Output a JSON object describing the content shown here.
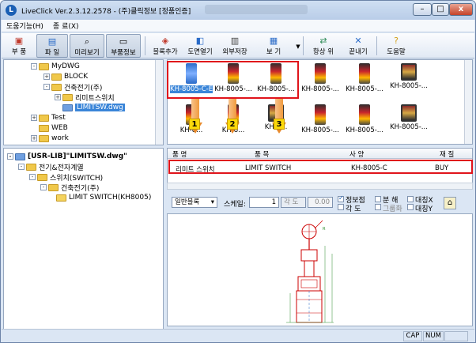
{
  "window": {
    "title": "LiveClick Ver.2.3.12.2578 - (주)클릭정보 [정품인증]",
    "minimize_glyph": "–",
    "maximize_glyph": "□",
    "close_glyph": "x"
  },
  "menubar": {
    "items": [
      "도움기능(H)",
      "종 료(X)"
    ]
  },
  "toolbar": {
    "buttons": [
      {
        "label": "부 품",
        "icon": "parts-icon"
      },
      {
        "label": "파 일",
        "icon": "file-icon"
      },
      {
        "label": "미리보기",
        "icon": "preview-icon"
      },
      {
        "label": "부품정보",
        "icon": "info-icon"
      },
      {
        "label": "블록추가",
        "icon": "add-block-icon"
      },
      {
        "label": "도면열기",
        "icon": "open-drawing-icon"
      },
      {
        "label": "외부저장",
        "icon": "save-icon"
      },
      {
        "label": "보 기",
        "icon": "view-icon"
      },
      {
        "label": "항상 위",
        "icon": "pin-icon"
      },
      {
        "label": "끝내기",
        "icon": "exit-icon"
      },
      {
        "label": "도움말",
        "icon": "help-icon"
      }
    ]
  },
  "folder_tree": {
    "items": [
      {
        "label": "MyDWG",
        "exp": "-"
      },
      {
        "label": "BLOCK",
        "exp": "+"
      },
      {
        "label": "건축전기(주)",
        "exp": "-"
      },
      {
        "label": "리미트스위치",
        "exp": "+"
      },
      {
        "label": "LIMITSW.dwg",
        "exp": ""
      },
      {
        "label": "Test",
        "exp": "+"
      },
      {
        "label": "WEB",
        "exp": ""
      },
      {
        "label": "work",
        "exp": "+"
      }
    ]
  },
  "library_tree": {
    "items": [
      {
        "label": "[USR-LIB]\"LIMITSW.dwg\"",
        "exp": "-"
      },
      {
        "label": "전기&전자계열",
        "exp": "-"
      },
      {
        "label": "스위치(SWITCH)",
        "exp": "-"
      },
      {
        "label": "건축전기(주)",
        "exp": "-"
      },
      {
        "label": "LIMIT SWITCH(KH8005)",
        "exp": ""
      }
    ]
  },
  "thumbnails": {
    "row1": [
      {
        "label": "KH-8005-C-E",
        "selected": true
      },
      {
        "label": "KH-8005-..."
      },
      {
        "label": "KH-8005-..."
      },
      {
        "label": "KH-8005-..."
      },
      {
        "label": "KH-8005-..."
      },
      {
        "label": "KH-8005-..."
      }
    ],
    "row2": [
      {
        "label": "KH-8..."
      },
      {
        "label": "KH-8..."
      },
      {
        "label": "KH-8..."
      },
      {
        "label": "KH-8005-..."
      },
      {
        "label": "KH-8005-..."
      },
      {
        "label": "KH-8005-..."
      }
    ]
  },
  "parts_list": {
    "headers": [
      "품 명",
      "품 목",
      "사 양",
      "재 질"
    ],
    "row": {
      "name": "리미트 스위치",
      "item": "LIMIT SWITCH",
      "spec": "KH-8005-C",
      "material": "BUY"
    }
  },
  "markers": [
    "1",
    "2",
    "3"
  ],
  "options": {
    "block_type": "일반블록",
    "scale_label": "스케일:",
    "scale_value": "1",
    "angle_label": "각 도",
    "angle_value": "0.00",
    "checks": [
      {
        "label": "정보점",
        "checked": true
      },
      {
        "label": "각 도",
        "checked": false
      },
      {
        "label": "분 해",
        "checked": false
      },
      {
        "label": "그룹화",
        "checked": false
      },
      {
        "label": "대칭X",
        "checked": false
      },
      {
        "label": "대칭Y",
        "checked": false
      }
    ]
  },
  "statusbar": {
    "cap": "CAP",
    "num": "NUM"
  }
}
